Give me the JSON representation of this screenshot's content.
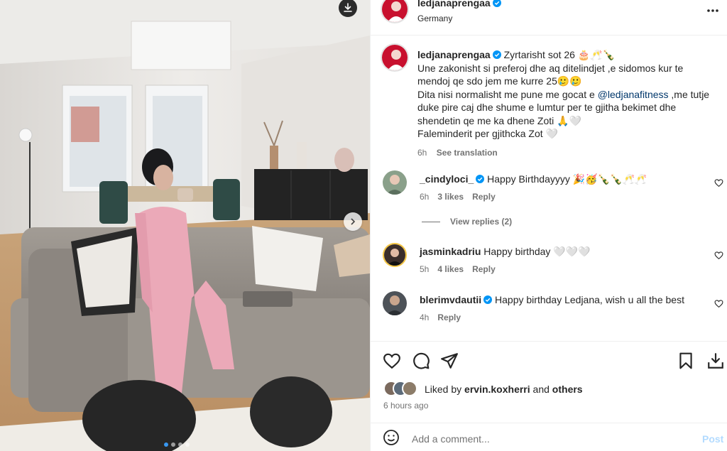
{
  "post": {
    "author": "ledjanaprengaa",
    "location": "Germany",
    "caption": {
      "username": "ledjanaprengaa",
      "line1": "Zyrtarisht sot 26 🎂🥂🍾",
      "line2": "Une zakonisht si preferoj dhe aq ditelindjet ,e sidomos kur te mendoj qe sdo jem me kurre 25🥲🥲",
      "line3_pre": "Dita nisi normalisht me pune me gocat e ",
      "line3_mention": "@ledjanafitness",
      "line3_post": " ,me tutje duke pire caj dhe shume e lumtur per te gjitha bekimet dhe shendetin qe me ka dhene Zoti 🙏🤍",
      "line4": "Faleminderit per gjithcka Zot 🤍",
      "time": "6h",
      "translate": "See translation"
    }
  },
  "comments": [
    {
      "username": "_cindyloci_",
      "verified": true,
      "text": "Happy Birthdayyyy 🎉🥳🍾🍾🥂🥂",
      "time": "6h",
      "likes": "3 likes",
      "reply": "Reply",
      "view_replies": "View replies (2)"
    },
    {
      "username": "jasminkadriu",
      "verified": false,
      "text": "Happy birthday 🤍🤍🤍",
      "time": "5h",
      "likes": "4 likes",
      "reply": "Reply"
    },
    {
      "username": "blerimvdautii",
      "verified": true,
      "text": "Happy birthday Ledjana, wish u all the best",
      "time": "4h",
      "likes": "",
      "reply": "Reply"
    }
  ],
  "likes_line": {
    "prefix": "Liked by",
    "user": "ervin.koxherri",
    "connector": "and",
    "others": "others"
  },
  "time_ago": "6 hours ago",
  "add_comment": {
    "placeholder": "Add a comment...",
    "post": "Post"
  },
  "carousel": {
    "total": 4,
    "active_index": 0
  },
  "icons": {
    "download": "download-icon",
    "next": "chevron-right-icon",
    "more": "more-horizontal-icon",
    "like": "heart-icon",
    "comment": "comment-icon",
    "share": "send-icon",
    "save": "bookmark-icon",
    "download_post": "download-tray-icon",
    "emoji": "emoji-icon",
    "verified": "verified-badge-icon"
  },
  "colors": {
    "verified": "#0095f6",
    "mention": "#00376b",
    "post_disabled": "#b3dbff",
    "active_dot": "#3897f0"
  }
}
